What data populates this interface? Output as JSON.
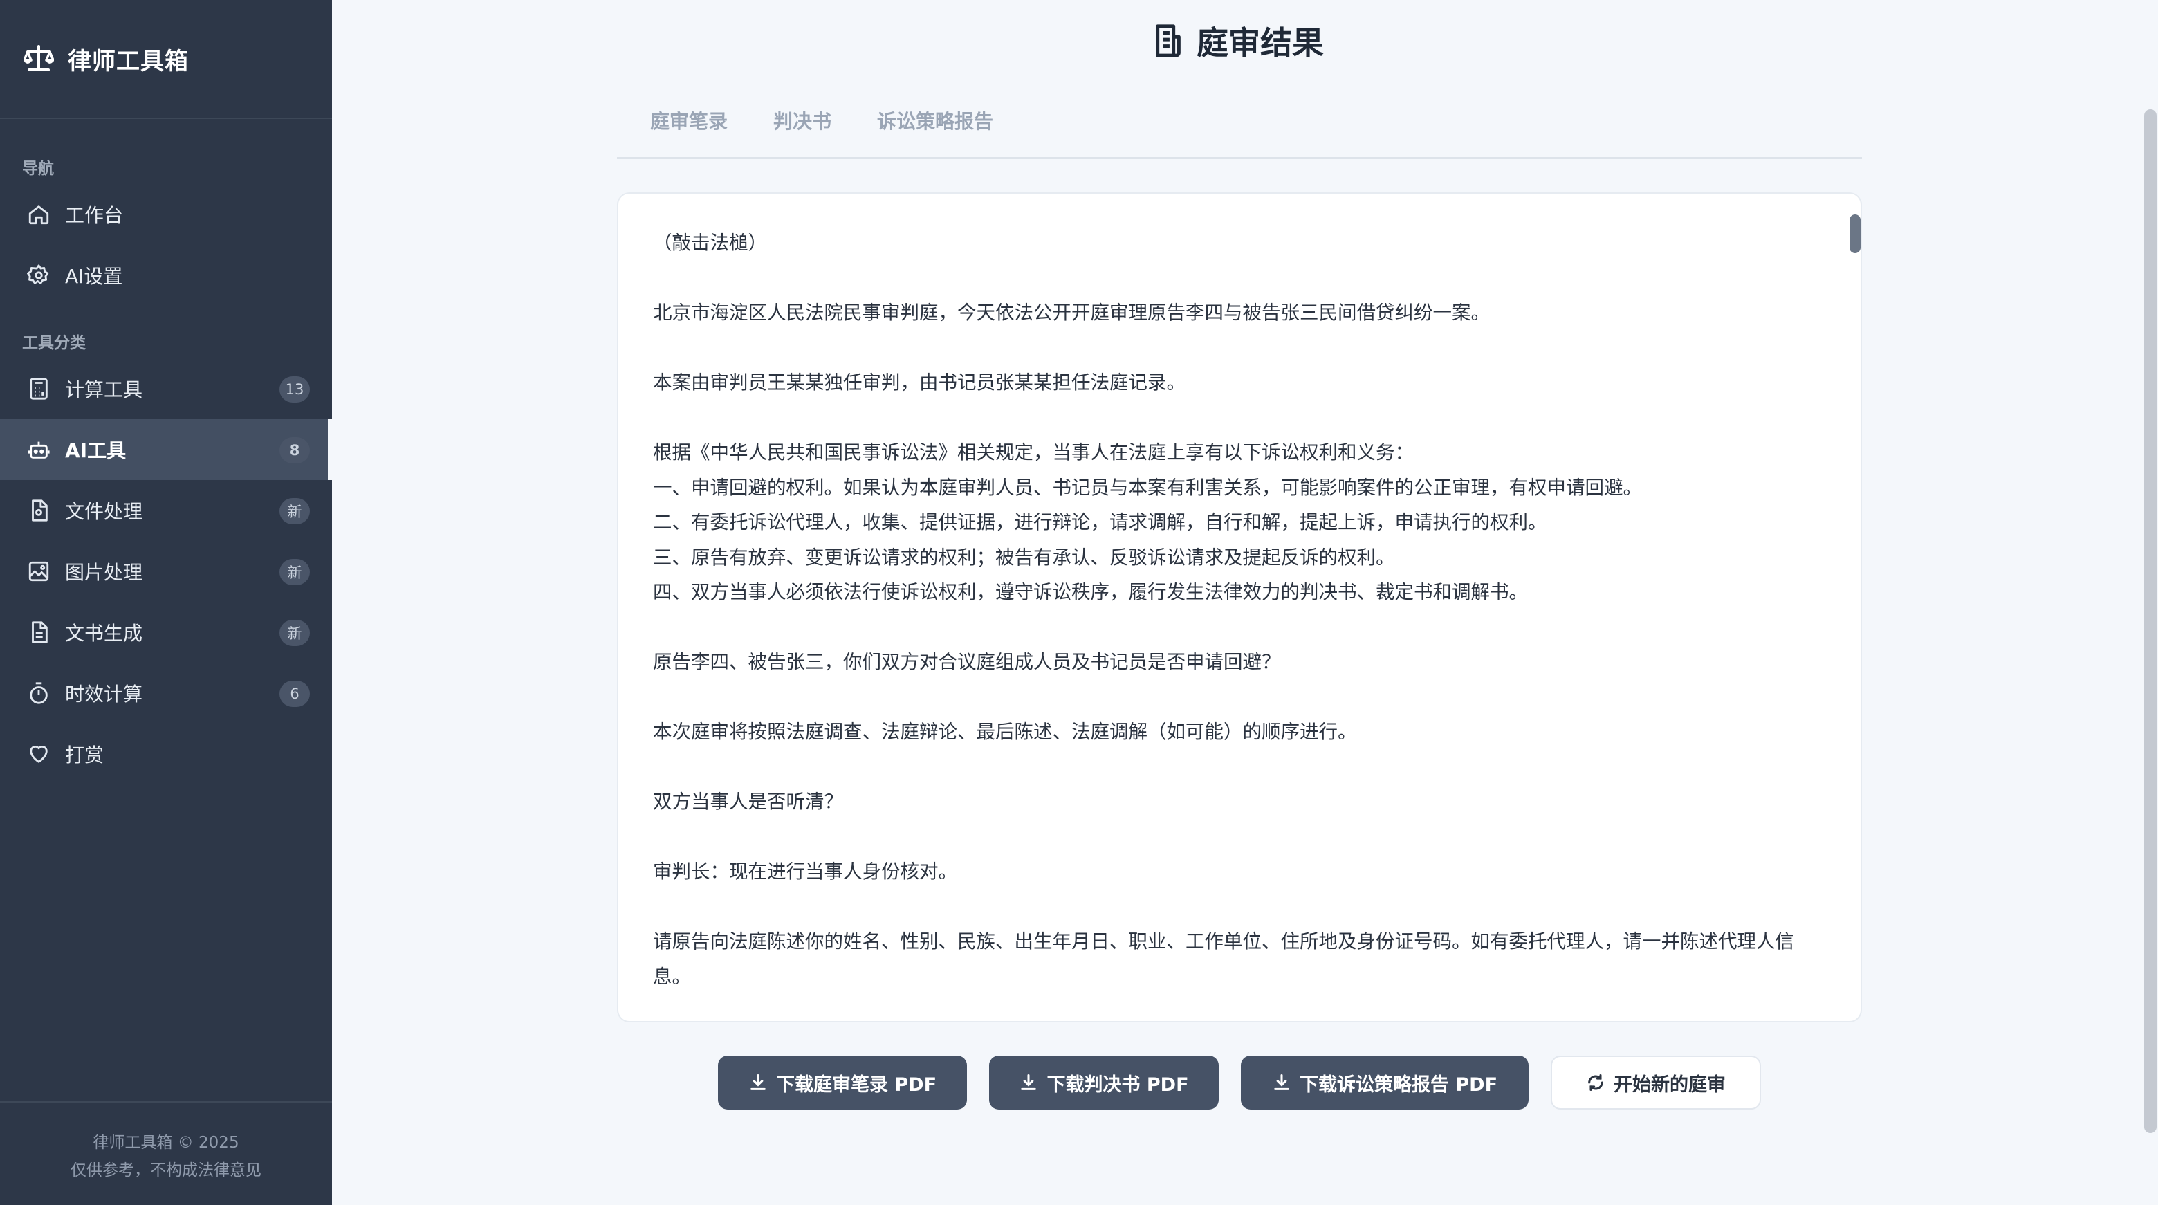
{
  "app": {
    "name": "律师工具箱"
  },
  "sidebar": {
    "nav_label": "导航",
    "nav": [
      {
        "label": "工作台",
        "icon": "home-icon"
      },
      {
        "label": "AI设置",
        "icon": "gear-icon"
      }
    ],
    "tools_label": "工具分类",
    "tools": [
      {
        "label": "计算工具",
        "badge": "13",
        "icon": "calculator-icon"
      },
      {
        "label": "AI工具",
        "badge": "8",
        "icon": "robot-icon",
        "active": true
      },
      {
        "label": "文件处理",
        "badge": "新",
        "icon": "file-icon"
      },
      {
        "label": "图片处理",
        "badge": "新",
        "icon": "image-icon"
      },
      {
        "label": "文书生成",
        "badge": "新",
        "icon": "document-icon"
      },
      {
        "label": "时效计算",
        "badge": "6",
        "icon": "stopwatch-icon"
      },
      {
        "label": "打赏",
        "icon": "heart-icon"
      }
    ],
    "footer": {
      "line1": "律师工具箱 © 2025",
      "line2": "仅供参考，不构成法律意见"
    }
  },
  "main": {
    "title": "庭审结果",
    "tabs": [
      "庭审笔录",
      "判决书",
      "诉讼策略报告"
    ],
    "transcript": [
      "（敲击法槌）",
      "",
      "北京市海淀区人民法院民事审判庭，今天依法公开开庭审理原告李四与被告张三民间借贷纠纷一案。",
      "",
      "本案由审判员王某某独任审判，由书记员张某某担任法庭记录。",
      "",
      "根据《中华人民共和国民事诉讼法》相关规定，当事人在法庭上享有以下诉讼权利和义务：",
      "一、申请回避的权利。如果认为本庭审判人员、书记员与本案有利害关系，可能影响案件的公正审理，有权申请回避。",
      "二、有委托诉讼代理人，收集、提供证据，进行辩论，请求调解，自行和解，提起上诉，申请执行的权利。",
      "三、原告有放弃、变更诉讼请求的权利；被告有承认、反驳诉讼请求及提起反诉的权利。",
      "四、双方当事人必须依法行使诉讼权利，遵守诉讼秩序，履行发生法律效力的判决书、裁定书和调解书。",
      "",
      "原告李四、被告张三，你们双方对合议庭组成人员及书记员是否申请回避？",
      "",
      "本次庭审将按照法庭调查、法庭辩论、最后陈述、法庭调解（如可能）的顺序进行。",
      "",
      "双方当事人是否听清？",
      "",
      "审判长：现在进行当事人身份核对。",
      "",
      "请原告向法庭陈述你的姓名、性别、民族、出生年月日、职业、工作单位、住所地及身份证号码。如有委托代理人，请一并陈述代理人信",
      "息。"
    ]
  },
  "actions": {
    "download_transcript": "下载庭审笔录 PDF",
    "download_judgment": "下载判决书 PDF",
    "download_strategy": "下载诉讼策略报告 PDF",
    "new_trial": "开始新的庭审"
  }
}
